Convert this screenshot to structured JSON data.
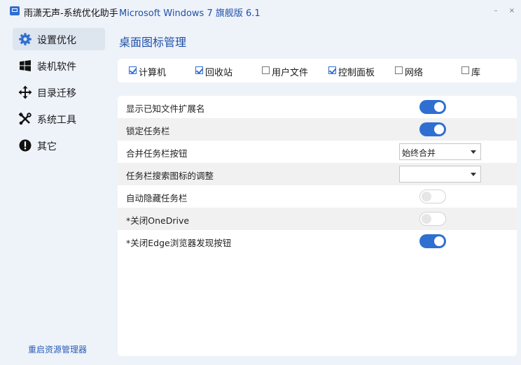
{
  "window": {
    "title": "雨潇无声-系统优化助手",
    "os_info": "Microsoft Windows 7 旗舰版  6.1",
    "min_glyph": "–",
    "close_glyph": "×"
  },
  "sidebar": {
    "items": [
      {
        "label": "设置优化",
        "icon": "gear-icon",
        "active": true
      },
      {
        "label": "装机软件",
        "icon": "windows-icon",
        "active": false
      },
      {
        "label": "目录迁移",
        "icon": "move-arrows-icon",
        "active": false
      },
      {
        "label": "系统工具",
        "icon": "tools-icon",
        "active": false
      },
      {
        "label": "其它",
        "icon": "info-icon",
        "active": false
      }
    ],
    "footer_link": "重启资源管理器"
  },
  "content": {
    "title": "桌面图标管理",
    "desktop_icons": [
      {
        "label": "计算机",
        "checked": true
      },
      {
        "label": "回收站",
        "checked": true
      },
      {
        "label": "用户文件",
        "checked": false
      },
      {
        "label": "控制面板",
        "checked": true
      },
      {
        "label": "网络",
        "checked": false
      },
      {
        "label": "库",
        "checked": false
      }
    ],
    "settings": [
      {
        "label": "显示已知文件扩展名",
        "control": "toggle",
        "on": true
      },
      {
        "label": "锁定任务栏",
        "control": "toggle",
        "on": true
      },
      {
        "label": "合并任务栏按钮",
        "control": "select",
        "value": "始终合并"
      },
      {
        "label": "任务栏搜索图标的调整",
        "control": "select",
        "value": ""
      },
      {
        "label": "自动隐藏任务栏",
        "control": "toggle",
        "on": false
      },
      {
        "label": "*关闭OneDrive",
        "control": "toggle",
        "on": false
      },
      {
        "label": "*关闭Edge浏览器发现按钮",
        "control": "toggle",
        "on": true
      }
    ]
  },
  "colors": {
    "accent": "#2f6fd2",
    "title_blue": "#1f4fa8",
    "window_bg": "#eef3fa",
    "panel_bg": "#ffffff",
    "row_alt_bg": "#f1f1f1"
  }
}
